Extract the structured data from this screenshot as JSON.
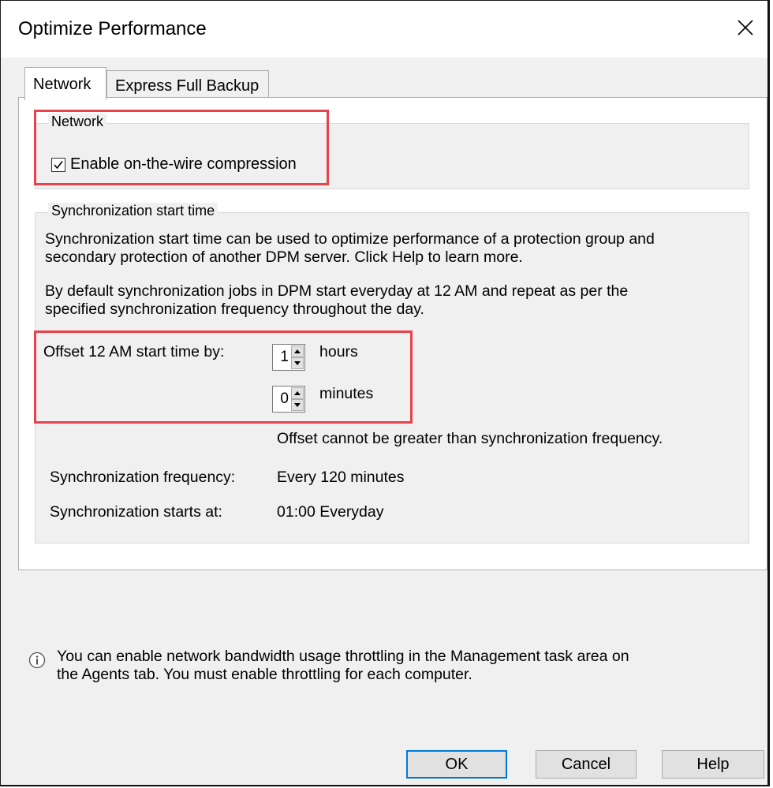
{
  "window": {
    "title": "Optimize Performance",
    "close_glyph": "✕"
  },
  "tabs": [
    {
      "label": "Network",
      "active": true
    },
    {
      "label": "Express Full Backup",
      "active": false
    }
  ],
  "network_group": {
    "legend": "Network",
    "checkbox_label": "Enable on-the-wire compression",
    "checked": true
  },
  "sync_group": {
    "legend": "Synchronization start time",
    "desc1_line1": "Synchronization start time can be used to optimize performance of a protection group and",
    "desc1_line2": "secondary protection of another DPM server. Click Help to learn more.",
    "desc2_line1": "By default synchronization jobs in DPM start everyday at 12 AM and repeat as per the",
    "desc2_line2": "specified synchronization frequency throughout the day.",
    "offset_label": "Offset 12 AM start time by:",
    "hours_value": "1",
    "hours_unit": "hours",
    "minutes_value": "0",
    "minutes_unit": "minutes",
    "offset_note": "Offset cannot be greater than synchronization frequency.",
    "frequency_label": "Synchronization frequency:",
    "frequency_value": "Every 120 minutes",
    "starts_label": "Synchronization starts at:",
    "starts_value": "01:00 Everyday"
  },
  "info": {
    "line1": "You can enable network bandwidth usage throttling in the Management task area on",
    "line2": "the Agents tab. You must enable throttling for each computer."
  },
  "buttons": {
    "ok": "OK",
    "cancel": "Cancel",
    "help": "Help"
  },
  "colors": {
    "highlight": "#e8424b",
    "default_button_border": "#0078d7",
    "dialog_bg": "#f0f0f0"
  }
}
